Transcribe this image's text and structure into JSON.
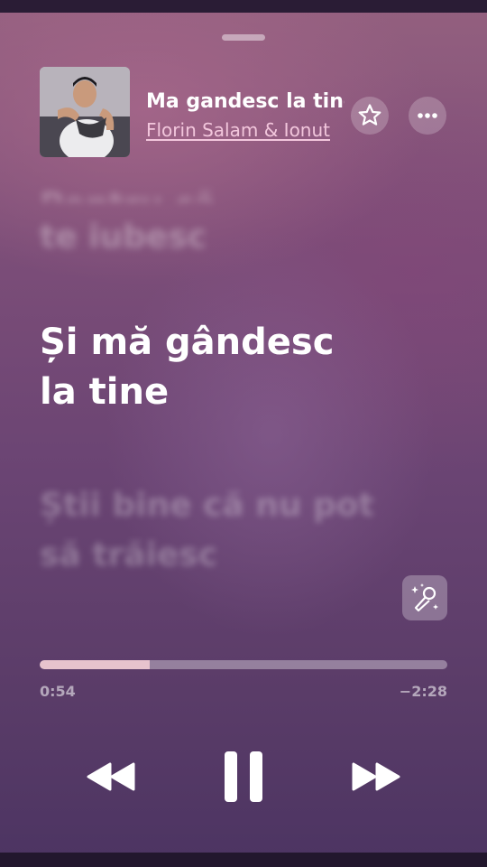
{
  "track": {
    "title": "Ma gandesc la tine",
    "artist": "Florin Salam & Ionut"
  },
  "header": {
    "favorite_icon": "star-icon",
    "more_icon": "ellipsis-icon"
  },
  "lyrics": {
    "previous_partial": "Pentru că",
    "previous": "te iubesc",
    "current_line1": "Și mă gândesc",
    "current_line2": "la tine",
    "next_line1": "Știi bine că nu pot",
    "next_line2": "să trăiesc"
  },
  "sing_button_icon": "microphone-sparkles-icon",
  "playback": {
    "elapsed": "0:54",
    "remaining": "−2:28",
    "progress_fraction": 0.27
  },
  "controls": {
    "rewind_icon": "rewind-icon",
    "pause_icon": "pause-icon",
    "forward_icon": "fast-forward-icon"
  },
  "colors": {
    "accent_artist": "#f2c6dc",
    "progress_fill": "#e7c3cd"
  }
}
